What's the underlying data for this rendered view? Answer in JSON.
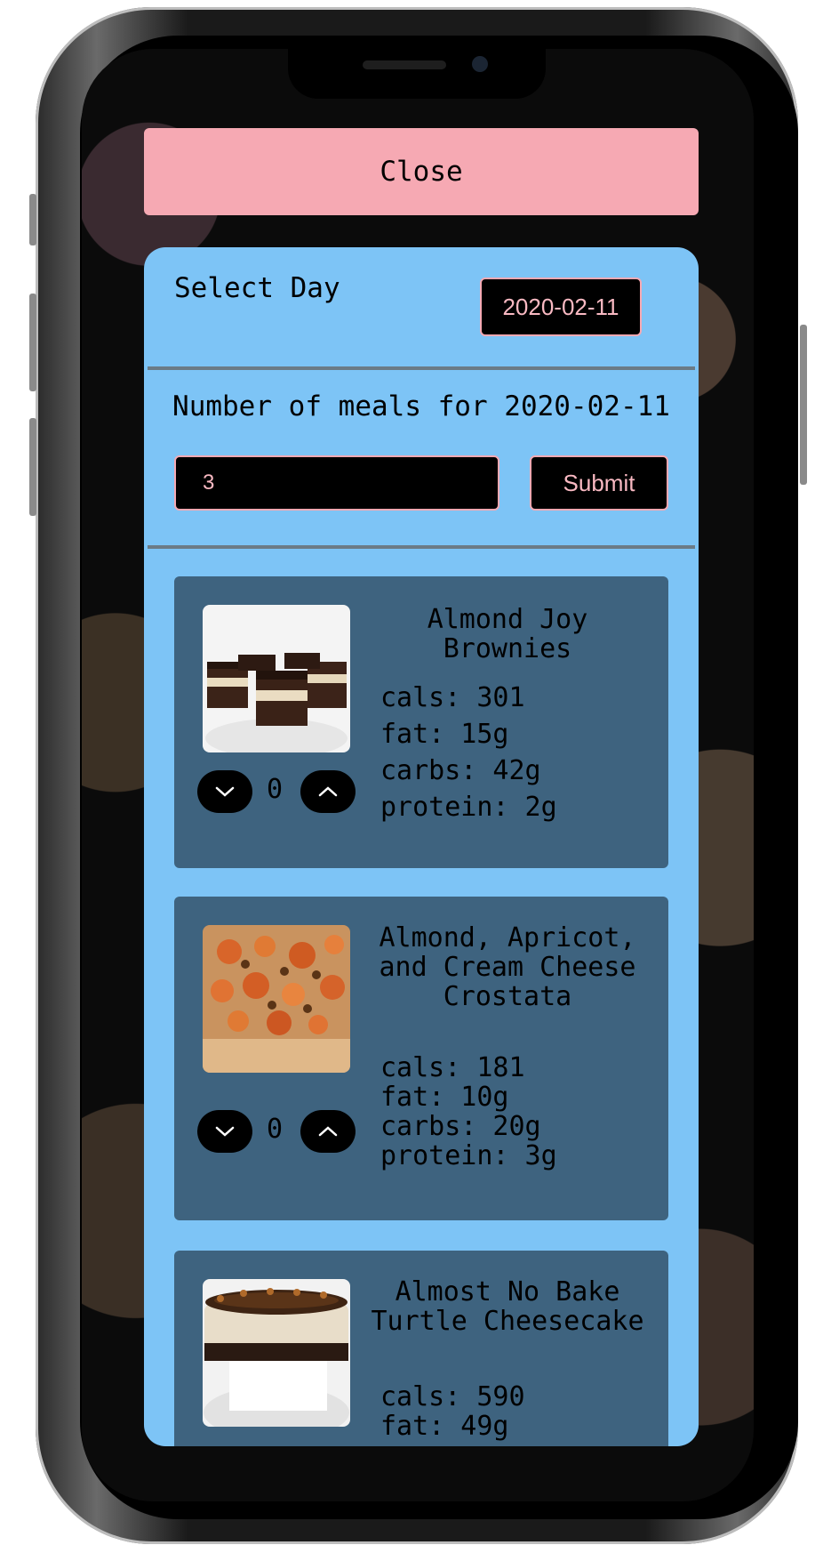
{
  "header": {
    "close_label": "Close"
  },
  "day_selector": {
    "label": "Select Day",
    "date_value": "2020-02-11"
  },
  "meals": {
    "label": "Number of meals for 2020-02-11",
    "input_value": "3",
    "submit_label": "Submit"
  },
  "recipes": [
    {
      "title": "Almond Joy Brownies",
      "cals": "cals: 301",
      "fat": "fat: 15g",
      "carbs": "carbs: 42g",
      "protein": "protein: 2g",
      "count": "0"
    },
    {
      "title": "Almond, Apricot, and Cream Cheese Crostata",
      "cals": "cals: 181",
      "fat": "fat: 10g",
      "carbs": "carbs: 20g",
      "protein": "protein: 3g",
      "count": "0"
    },
    {
      "title": "Almost No Bake Turtle Cheesecake",
      "cals": "cals: 590",
      "fat": "fat: 49g"
    }
  ],
  "colors": {
    "accent_pink": "#f6a9b3",
    "panel_blue": "#7dc4f6",
    "card_blue": "#3e637f"
  }
}
